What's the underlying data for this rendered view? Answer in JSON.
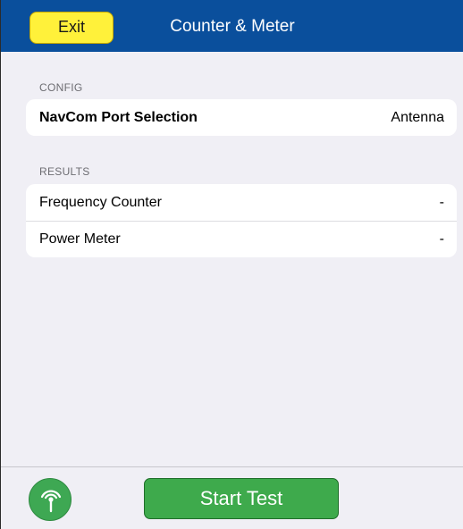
{
  "header": {
    "exit_label": "Exit",
    "title": "Counter & Meter"
  },
  "config": {
    "section_label": "CONFIG",
    "rows": [
      {
        "label": "NavCom Port Selection",
        "value": "Antenna"
      }
    ]
  },
  "results": {
    "section_label": "RESULTS",
    "rows": [
      {
        "label": "Frequency Counter",
        "value": "-"
      },
      {
        "label": "Power Meter",
        "value": "-"
      }
    ]
  },
  "footer": {
    "antenna_icon": "antenna-icon",
    "start_label": "Start Test"
  },
  "colors": {
    "header_bg": "#0a4f9c",
    "exit_bg": "#fff13a",
    "start_bg": "#3eaa4c",
    "page_bg": "#f0eff5"
  }
}
